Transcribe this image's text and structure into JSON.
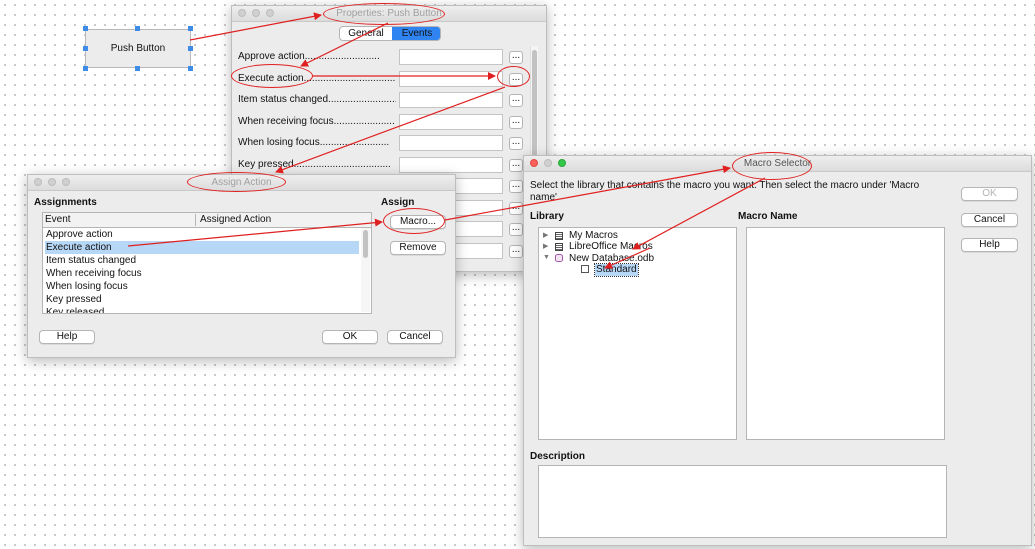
{
  "canvas": {
    "push_button_label": "Push Button"
  },
  "properties": {
    "title": "Properties: Push Button",
    "tabs": [
      {
        "label": "General",
        "active": false
      },
      {
        "label": "Events",
        "active": true
      }
    ],
    "rows": [
      {
        "label": "Approve action..........................."
      },
      {
        "label": "Execute action..................................."
      },
      {
        "label": "Item status changed........................."
      },
      {
        "label": "When receiving focus......................"
      },
      {
        "label": "When losing focus........................."
      },
      {
        "label": "Key pressed..................................."
      },
      {
        "label": ""
      },
      {
        "label": ""
      },
      {
        "label": ""
      },
      {
        "label": ""
      }
    ],
    "ellipsis": "..."
  },
  "assign_action": {
    "title": "Assign Action",
    "assignments_heading": "Assignments",
    "assign_heading": "Assign",
    "col_event": "Event",
    "col_assigned": "Assigned Action",
    "events": [
      {
        "label": "Approve action",
        "selected": false
      },
      {
        "label": "Execute action",
        "selected": true
      },
      {
        "label": "Item status changed",
        "selected": false
      },
      {
        "label": "When receiving focus",
        "selected": false
      },
      {
        "label": "When losing focus",
        "selected": false
      },
      {
        "label": "Key pressed",
        "selected": false
      },
      {
        "label": "Key released",
        "selected": false
      }
    ],
    "macro_button": "Macro...",
    "remove_button": "Remove",
    "help_button": "Help",
    "ok_button": "OK",
    "cancel_button": "Cancel"
  },
  "macro_selector": {
    "title": "Macro Selector",
    "instruction": "Select the library that contains the macro you want. Then select the macro under 'Macro name'",
    "library_heading": "Library",
    "macro_name_heading": "Macro Name",
    "description_heading": "Description",
    "library_tree": [
      {
        "label": "My Macros",
        "icon": "library-icon",
        "expand": "▶",
        "level": 0
      },
      {
        "label": "LibreOffice Macros",
        "icon": "library-icon",
        "expand": "▶",
        "level": 0
      },
      {
        "label": "New Database.odb",
        "icon": "database-icon",
        "expand": "▼",
        "level": 0
      },
      {
        "label": "Standard",
        "icon": "module-icon",
        "expand": "",
        "level": 1,
        "selected": true
      }
    ],
    "ok_button": "OK",
    "cancel_button": "Cancel",
    "help_button": "Help"
  },
  "colors": {
    "annotation": "#e02020",
    "selection": "#b7d7f6",
    "active_tab": "#2f84f1",
    "handle": "#3e8ce8"
  }
}
